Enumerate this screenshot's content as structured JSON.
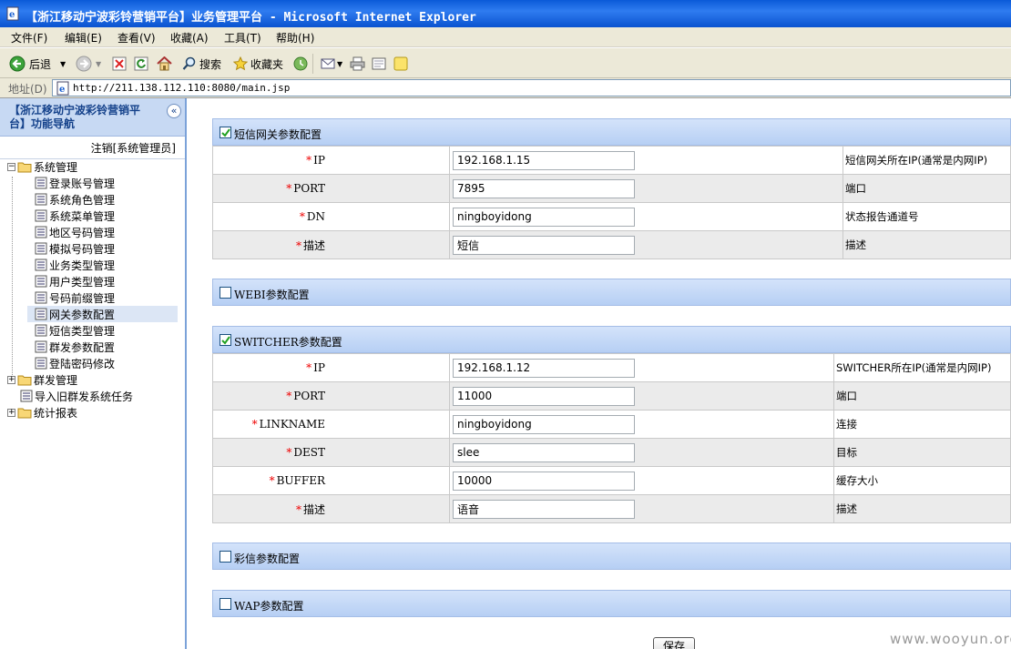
{
  "window": {
    "title": "【浙江移动宁波彩铃营销平台】业务管理平台 - Microsoft Internet Explorer"
  },
  "menu": [
    "文件(F)",
    "编辑(E)",
    "查看(V)",
    "收藏(A)",
    "工具(T)",
    "帮助(H)"
  ],
  "toolbar": {
    "back": "后退",
    "search": "搜索",
    "favorites": "收藏夹"
  },
  "address": {
    "label": "地址(D)",
    "url": "http://211.138.112.110:8080/main.jsp"
  },
  "nav": {
    "title": "【浙江移动宁波彩铃营销平台】功能导航",
    "collapse_glyph": "«",
    "logout": "注销[系统管理员]",
    "root_system": "系统管理",
    "system_items": [
      "登录账号管理",
      "系统角色管理",
      "系统菜单管理",
      "地区号码管理",
      "模拟号码管理",
      "业务类型管理",
      "用户类型管理",
      "号码前缀管理",
      "网关参数配置",
      "短信类型管理",
      "群发参数配置",
      "登陆密码修改"
    ],
    "selected_item": "网关参数配置",
    "root_mass": "群发管理",
    "import_task": "导入旧群发系统任务",
    "root_report": "统计报表",
    "expand_minus": "−",
    "expand_plus": "+"
  },
  "sections": {
    "sms": {
      "label": "短信网关参数配置",
      "checked": true,
      "rows": [
        {
          "key": "IP",
          "value": "192.168.1.15",
          "desc": "短信网关所在IP(通常是内网IP)"
        },
        {
          "key": "PORT",
          "value": "7895",
          "desc": "端口"
        },
        {
          "key": "DN",
          "value": "ningboyidong",
          "desc": "状态报告通道号"
        },
        {
          "key": "描述",
          "value": "短信",
          "desc": "描述"
        }
      ]
    },
    "webi": {
      "label": "WEBI参数配置",
      "checked": false
    },
    "switcher": {
      "label": "SWITCHER参数配置",
      "checked": true,
      "rows": [
        {
          "key": "IP",
          "value": "192.168.1.12",
          "desc": "SWITCHER所在IP(通常是内网IP)"
        },
        {
          "key": "PORT",
          "value": "11000",
          "desc": "端口"
        },
        {
          "key": "LINKNAME",
          "value": "ningboyidong",
          "desc": "连接"
        },
        {
          "key": "DEST",
          "value": "slee",
          "desc": "目标"
        },
        {
          "key": "BUFFER",
          "value": "10000",
          "desc": "缓存大小"
        },
        {
          "key": "描述",
          "value": "语音",
          "desc": "描述"
        }
      ]
    },
    "mms": {
      "label": "彩信参数配置",
      "checked": false
    },
    "wap": {
      "label": "WAP参数配置",
      "checked": false
    }
  },
  "required_mark": "*",
  "save_label": "保存",
  "watermark": "www.wooyun.org",
  "colors": {
    "titlebar": "#0a5ad8",
    "section_header": "#b6cff4",
    "required": "#e00000"
  }
}
